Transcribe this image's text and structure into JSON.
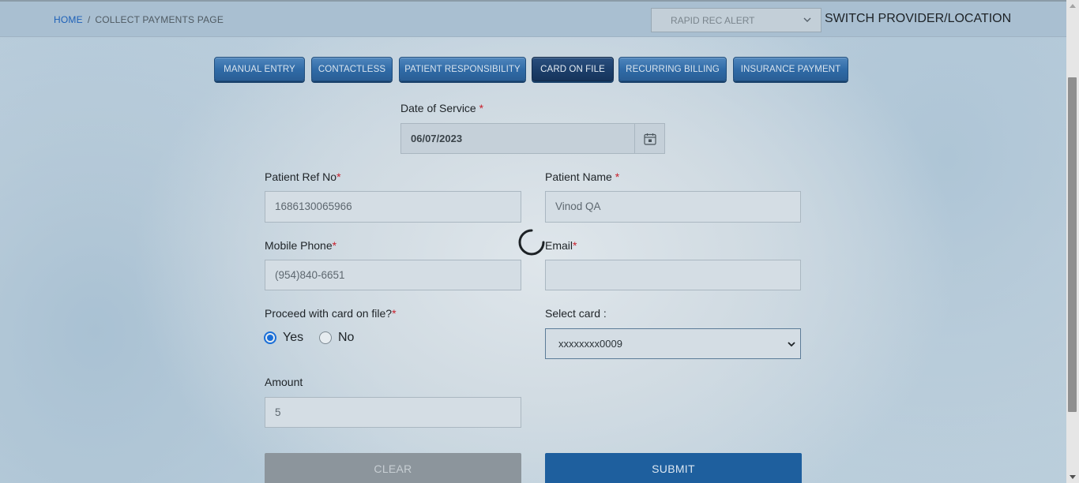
{
  "breadcrumb": {
    "home": "HOME",
    "separator": "/",
    "current": "COLLECT PAYMENTS PAGE"
  },
  "header": {
    "provider_select": "RAPID REC ALERT",
    "switch_link": "SWITCH PROVIDER/LOCATION"
  },
  "tabs": [
    {
      "label": "MANUAL ENTRY",
      "active": false
    },
    {
      "label": "CONTACTLESS",
      "active": false
    },
    {
      "label": "PATIENT RESPONSIBILITY",
      "active": false
    },
    {
      "label": "CARD ON FILE",
      "active": true
    },
    {
      "label": "RECURRING BILLING",
      "active": false
    },
    {
      "label": "INSURANCE PAYMENT",
      "active": false
    }
  ],
  "form": {
    "date_of_service": {
      "label": "Date of Service ",
      "required": "*",
      "value": "06/07/2023"
    },
    "patient_ref_no": {
      "label": "Patient Ref No",
      "required": "*",
      "value": "1686130065966"
    },
    "patient_name": {
      "label": "Patient Name ",
      "required": "*",
      "value": "Vinod QA"
    },
    "mobile_phone": {
      "label": "Mobile Phone",
      "required": "*",
      "value": "(954)840-6651"
    },
    "email": {
      "label": "Email",
      "required": "*",
      "value": ""
    },
    "proceed_card_on_file": {
      "label": "Proceed with card on file?",
      "required": "*",
      "options": [
        {
          "label": "Yes",
          "checked": true
        },
        {
          "label": "No",
          "checked": false
        }
      ]
    },
    "select_card": {
      "label": "Select card :",
      "value": "xxxxxxxx0009"
    },
    "amount": {
      "label": "Amount",
      "value": "5"
    }
  },
  "buttons": {
    "clear": "CLEAR",
    "submit": "SUBMIT"
  },
  "colors": {
    "accent": "#1e5f9e",
    "required": "#c8202c",
    "tab": "#2f6aa6",
    "tab_active": "#1b3d68"
  }
}
